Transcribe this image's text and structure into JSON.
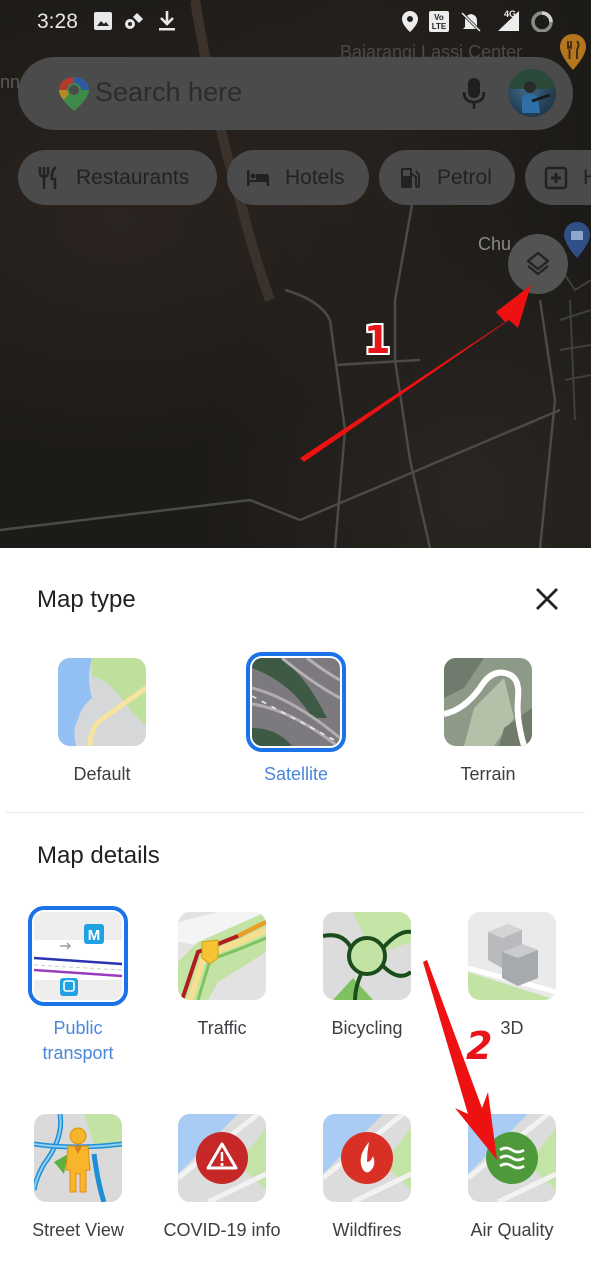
{
  "status_bar": {
    "time": "3:28",
    "icons_left": [
      "image-icon",
      "satellite-settings-icon",
      "download-icon"
    ],
    "icons_right": [
      "location-icon",
      "volte-icon",
      "mute-bell-icon",
      "4g-signal-icon",
      "loading-circle-icon"
    ],
    "network_label": "4G",
    "volte_label": "Vo LTE"
  },
  "map": {
    "labels": {
      "place_top_right": "Bajarangi Lassi Center",
      "place_mid_right": "Chu",
      "place_left_edge": "nn"
    }
  },
  "search": {
    "placeholder": "Search here"
  },
  "chips": [
    {
      "label": "Restaurants",
      "icon": "fork-knife-icon"
    },
    {
      "label": "Hotels",
      "icon": "bed-icon"
    },
    {
      "label": "Petrol",
      "icon": "fuel-pump-icon"
    },
    {
      "label": "H",
      "icon": "hospital-plus-icon"
    }
  ],
  "annotations": {
    "step1": "1",
    "step2": "2"
  },
  "sheet": {
    "map_type_title": "Map type",
    "map_types": [
      {
        "label": "Default",
        "selected": false
      },
      {
        "label": "Satellite",
        "selected": true
      },
      {
        "label": "Terrain",
        "selected": false
      }
    ],
    "map_details_title": "Map details",
    "map_details": [
      {
        "label": "Public transport",
        "line1": "Public",
        "line2": "transport",
        "selected": true
      },
      {
        "label": "Traffic",
        "selected": false
      },
      {
        "label": "Bicycling",
        "selected": false
      },
      {
        "label": "3D",
        "selected": false
      },
      {
        "label": "Street View",
        "selected": false
      },
      {
        "label": "COVID-19 info",
        "selected": false
      },
      {
        "label": "Wildfires",
        "selected": false
      },
      {
        "label": "Air Quality",
        "selected": false
      }
    ]
  },
  "colors": {
    "accent_blue": "#1a73e8",
    "selected_label": "#4a86d9",
    "annotation_red": "#e8141a"
  }
}
